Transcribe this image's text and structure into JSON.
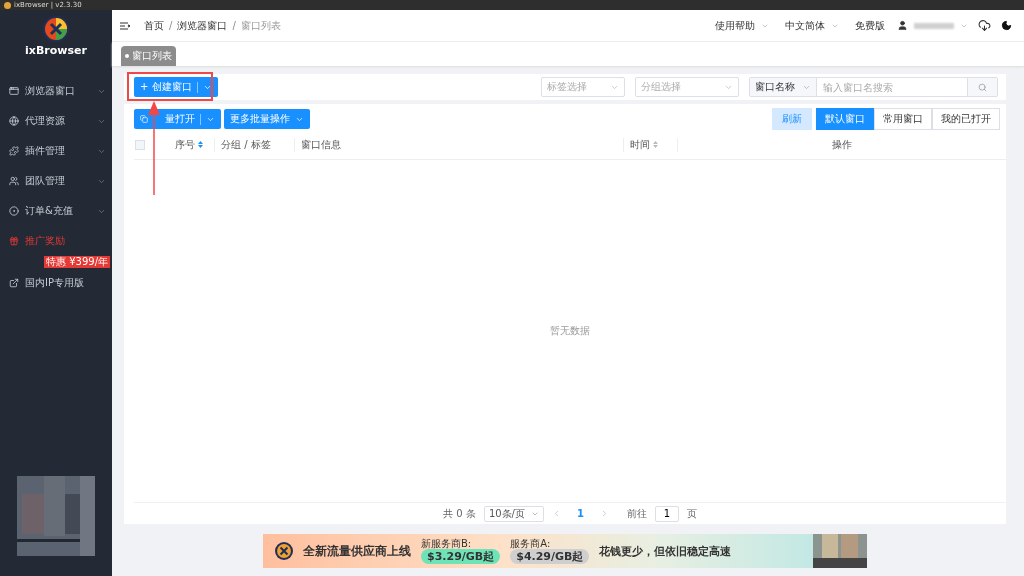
{
  "window": {
    "title": "ixBrowser | v2.3.30"
  },
  "sidebar": {
    "brand": "ixBrowser",
    "items": [
      {
        "label": "浏览器窗口",
        "expandable": true,
        "highlight": false
      },
      {
        "label": "代理资源",
        "expandable": true,
        "highlight": false
      },
      {
        "label": "插件管理",
        "expandable": true,
        "highlight": false
      },
      {
        "label": "团队管理",
        "expandable": true,
        "highlight": false
      },
      {
        "label": "订单&充值",
        "expandable": true,
        "highlight": false
      },
      {
        "label": "推广奖励",
        "expandable": false,
        "highlight": true
      },
      {
        "label": "国内IP专用版",
        "expandable": false,
        "highlight": false,
        "badge": "特惠 ¥399/年"
      }
    ]
  },
  "header": {
    "breadcrumb": [
      {
        "label": "首页",
        "current": false
      },
      {
        "label": "浏览器窗口",
        "current": false
      },
      {
        "label": "窗口列表",
        "current": true
      }
    ],
    "separators": [
      "/",
      "/"
    ],
    "menus": [
      {
        "label": "使用帮助",
        "dropdown": true
      },
      {
        "label": "中文简体",
        "dropdown": true
      },
      {
        "label": "免费版",
        "dropdown": false
      }
    ]
  },
  "tabs": [
    {
      "label": "窗口列表",
      "selected": true
    }
  ],
  "toolbar": {
    "create_button": "+ 创建窗口",
    "tag_select": {
      "placeholder": "标签选择"
    },
    "group_select": {
      "placeholder": "分组选择"
    },
    "search_type": "窗口名称",
    "search": {
      "placeholder": "输入窗口名搜索"
    }
  },
  "actions": {
    "batch_open": "量打开",
    "more_batch": "更多批量操作",
    "refresh": "刷新",
    "views": [
      {
        "label": "默认窗口",
        "selected": true
      },
      {
        "label": "常用窗口",
        "selected": false
      },
      {
        "label": "我的已打开",
        "selected": false
      }
    ]
  },
  "table": {
    "select_all": {
      "checked": false
    },
    "columns": [
      {
        "label": "序号",
        "sortable": true
      },
      {
        "label": "分组 / 标签",
        "sortable": false
      },
      {
        "label": "窗口信息",
        "sortable": false
      },
      {
        "label": "时间",
        "sortable": true
      },
      {
        "label": "操作",
        "sortable": false
      }
    ],
    "empty_text": "暂无数据"
  },
  "pagination": {
    "total": "共 0 条",
    "page_size": "10条/页",
    "current_page": "1",
    "goto_label": "前往",
    "goto_value": "1",
    "page_unit": "页"
  },
  "banner": {
    "headline": "全新流量供应商上线",
    "offer_b_label": "新服务商B:",
    "offer_b_price": "$3.29/GB起",
    "offer_a_label": "服务商A:",
    "offer_a_price": "$4.29/GB起",
    "slogan": "花钱更少，但依旧稳定高速"
  }
}
